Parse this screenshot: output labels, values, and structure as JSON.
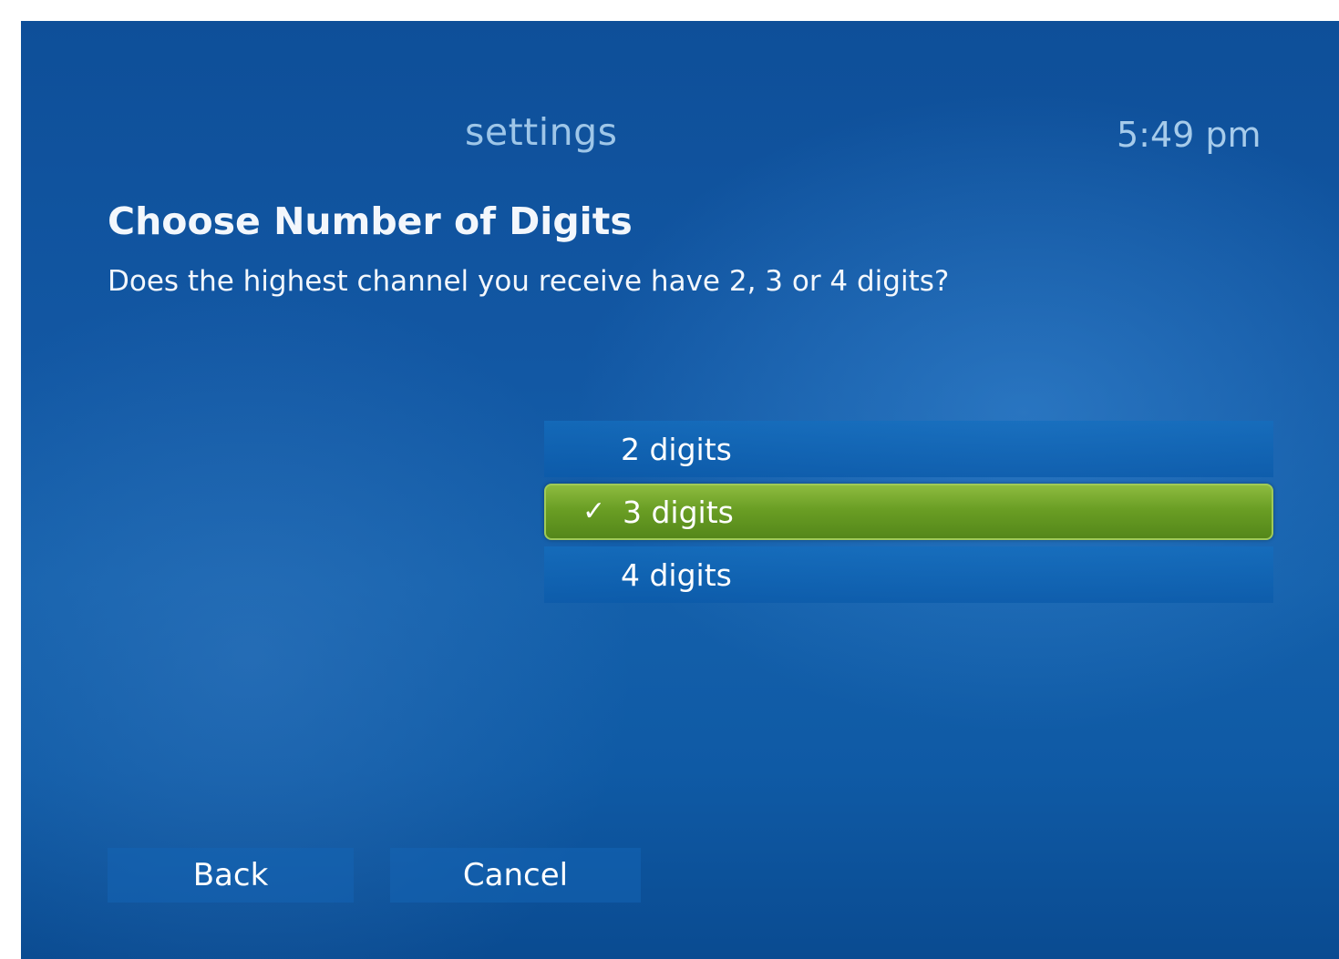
{
  "header": {
    "title": "settings",
    "time": "5:49 pm"
  },
  "page": {
    "heading": "Choose Number of Digits",
    "question": "Does the highest channel you receive have 2, 3 or 4 digits?"
  },
  "options": [
    {
      "label": "2 digits",
      "selected": false
    },
    {
      "label": "3 digits",
      "selected": true
    },
    {
      "label": "4 digits",
      "selected": false
    }
  ],
  "checkmark": "✓",
  "buttons": {
    "back": "Back",
    "cancel": "Cancel"
  },
  "colors": {
    "background": "#1257a3",
    "selected": "#6a9e24",
    "title_text": "#9ec6e8"
  }
}
